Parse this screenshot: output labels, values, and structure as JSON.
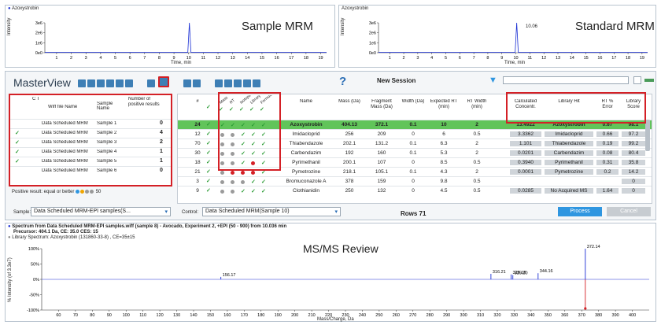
{
  "sample_mrm": {
    "label": "Azoxystrobin",
    "title": "Sample MRM",
    "ylabel": "Intensity",
    "xlabel": "Time, min",
    "yticks": [
      "3e6",
      "2e6",
      "1e6",
      "0e0"
    ],
    "xticks": [
      "1",
      "2",
      "3",
      "4",
      "5",
      "6",
      "7",
      "8",
      "9",
      "10",
      "11",
      "12",
      "13",
      "14",
      "15",
      "16",
      "17",
      "18",
      "19"
    ]
  },
  "standard_mrm": {
    "label": "Azoxystrobin",
    "title": "Standard MRM",
    "ylabel": "Intensity",
    "xlabel": "Time, min",
    "peak_label": "10.06",
    "yticks": [
      "3e6",
      "2e6",
      "1e6",
      "0e0"
    ],
    "xticks": [
      "1",
      "2",
      "3",
      "4",
      "5",
      "6",
      "7",
      "8",
      "9",
      "10",
      "11",
      "12",
      "13",
      "14",
      "15",
      "16",
      "17",
      "18",
      "19"
    ]
  },
  "masterview": {
    "title": "MasterView",
    "session": "New Session",
    "help": "?"
  },
  "sample_table": {
    "headers": [
      "C T R L",
      "Wiff file Name",
      "Sample Name",
      "Number of positive results"
    ],
    "rows": [
      {
        "ctrl": "",
        "file": "Data Scheduled MRM",
        "sample": "Sample 1",
        "num": "0"
      },
      {
        "ctrl": "✓",
        "file": "Data Scheduled MRM",
        "sample": "Sample 2",
        "num": "4"
      },
      {
        "ctrl": "✓",
        "file": "Data Scheduled MRM",
        "sample": "Sample 3",
        "num": "2"
      },
      {
        "ctrl": "✓",
        "file": "Data Scheduled MRM",
        "sample": "Sample 4",
        "num": "1"
      },
      {
        "ctrl": "✓",
        "file": "Data Scheduled MRM",
        "sample": "Sample 5",
        "num": "1"
      },
      {
        "ctrl": "",
        "file": "Data Scheduled MRM",
        "sample": "Sample 6",
        "num": "0"
      }
    ],
    "filter_text": "Positive result: equal or better",
    "filter_value": "50"
  },
  "compound_table": {
    "headers": {
      "num": "#",
      "flags": [
        "Mass",
        "RT",
        "Isotope",
        "Library",
        "Formula"
      ],
      "name": "Name",
      "mass": "Mass (Da)",
      "frag": "Fragment Mass (Da)",
      "width": "Width (Da)",
      "exp_rt": "Expected RT (min)",
      "rt_width": "RT Width (min)",
      "conc": "Calculated Concentr.",
      "lib_hit": "Library Hit",
      "rt_err": "RT % Error",
      "lib_score": "Library Score"
    },
    "rows": [
      {
        "n": "24",
        "name": "Azoxystrobin",
        "mass": "404.13",
        "frag": "372.1",
        "width": "0.1",
        "exp": "10",
        "rtw": "2",
        "conc": "13.4922",
        "hit": "Azoxystrobin",
        "err": "0.67",
        "score": "98.1",
        "dots": [
          "chk",
          "chk",
          "chk",
          "chk",
          "chk"
        ]
      },
      {
        "n": "12",
        "name": "Imidacloprid",
        "mass": "256",
        "frag": "209",
        "width": "0",
        "exp": "6",
        "rtw": "0.5",
        "conc": "3.3362",
        "hit": "Imidacloprid",
        "err": "0.66",
        "score": "97.2",
        "dots": [
          "gray",
          "gray",
          "chk",
          "chk",
          "chk"
        ]
      },
      {
        "n": "70",
        "name": "Thiabendazole",
        "mass": "202.1",
        "frag": "131.2",
        "width": "0.1",
        "exp": "6.3",
        "rtw": "2",
        "conc": "1.101",
        "hit": "Thiabendazole",
        "err": "0.19",
        "score": "99.2",
        "dots": [
          "gray",
          "gray",
          "chk",
          "chk",
          "chk"
        ]
      },
      {
        "n": "30",
        "name": "Carbendazim",
        "mass": "192",
        "frag": "160",
        "width": "0.1",
        "exp": "5.3",
        "rtw": "2",
        "conc": "0.0201",
        "hit": "Carbendazim",
        "err": "0.08",
        "score": "80.4",
        "dots": [
          "gray",
          "gray",
          "chk",
          "chk",
          "chk"
        ]
      },
      {
        "n": "18",
        "name": "Pyrimethanil",
        "mass": "200.1",
        "frag": "107",
        "width": "0",
        "exp": "8.5",
        "rtw": "0.5",
        "conc": "0.3940",
        "hit": "Pyrimethanil",
        "err": "0.31",
        "score": "35.8",
        "dots": [
          "gray",
          "gray",
          "chk",
          "red",
          "chk"
        ]
      },
      {
        "n": "21",
        "name": "Pymetrozine",
        "mass": "218.1",
        "frag": "105.1",
        "width": "0.1",
        "exp": "4.3",
        "rtw": "2",
        "conc": "0.0001",
        "hit": "Pymetrozine",
        "err": "0.2",
        "score": "14.2",
        "dots": [
          "gray",
          "red",
          "red",
          "red",
          "chk"
        ]
      },
      {
        "n": "3",
        "name": "Bromuconazole A",
        "mass": "378",
        "frag": "159",
        "width": "0",
        "exp": "9.8",
        "rtw": "0.5",
        "conc": "",
        "hit": "",
        "err": "",
        "score": "0",
        "dots": [
          "gray",
          "gray",
          "gray",
          "chk",
          "chk"
        ]
      },
      {
        "n": "9",
        "name": "Clothianidin",
        "mass": "250",
        "frag": "132",
        "width": "0",
        "exp": "4.5",
        "rtw": "0.5",
        "conc": "0.0285",
        "hit": "No Acquired MS",
        "err": "1.64",
        "score": "0",
        "dots": [
          "gray",
          "gray",
          "chk",
          "chk",
          "chk"
        ]
      }
    ]
  },
  "bottom_bar": {
    "sample_label": "Sample:",
    "sample_value": "Data Scheduled MRM-EPI samples(S...",
    "control_label": "Control:",
    "control_value": "Data Scheduled MRM(Sample 10)",
    "rows": "Rows 71",
    "process": "Process",
    "cancel": "Cancel"
  },
  "msms": {
    "header1": "Spectrum from Data Scheduled MRM-EPI samples.wiff (sample 8) - Avocado, Experiment 2, +EPI (50 - 900) from 10.036 min",
    "header2": "Precursor: 404.1 Da, CE: 35.0 CES: 15",
    "header3": "Library Spectrum: Azoxystrobin (131860-33-8) , CE=35±15",
    "title": "MS/MS Review",
    "ylabel": "% Intensity (of 3.3e7)",
    "xlabel": "Mass/Charge, Da",
    "yticks": [
      "100%",
      "50%",
      "0%",
      "-50%",
      "-100%"
    ],
    "xticks": [
      "60",
      "70",
      "80",
      "90",
      "100",
      "110",
      "120",
      "130",
      "140",
      "150",
      "160",
      "170",
      "180",
      "190",
      "200",
      "210",
      "220",
      "230",
      "240",
      "250",
      "260",
      "270",
      "280",
      "290",
      "300",
      "310",
      "320",
      "330",
      "340",
      "350",
      "360",
      "370",
      "380",
      "390",
      "400"
    ],
    "peaks": [
      {
        "mz": 156.17,
        "label": "156.17",
        "h": 0.08
      },
      {
        "mz": 316.21,
        "label": "316.21",
        "h": 0.18
      },
      {
        "mz": 328.18,
        "label": "328.18",
        "h": 0.16
      },
      {
        "mz": 329.2,
        "label": "329.20",
        "h": 0.14
      },
      {
        "mz": 344.16,
        "label": "344.16",
        "h": 0.2
      },
      {
        "mz": 372.14,
        "label": "372.14",
        "h": 1.0
      }
    ]
  },
  "colors": {
    "accent": "#2f96e0",
    "highlight": "#d42026",
    "selected_row": "#61c45a",
    "trace": "#1a2fd4"
  }
}
